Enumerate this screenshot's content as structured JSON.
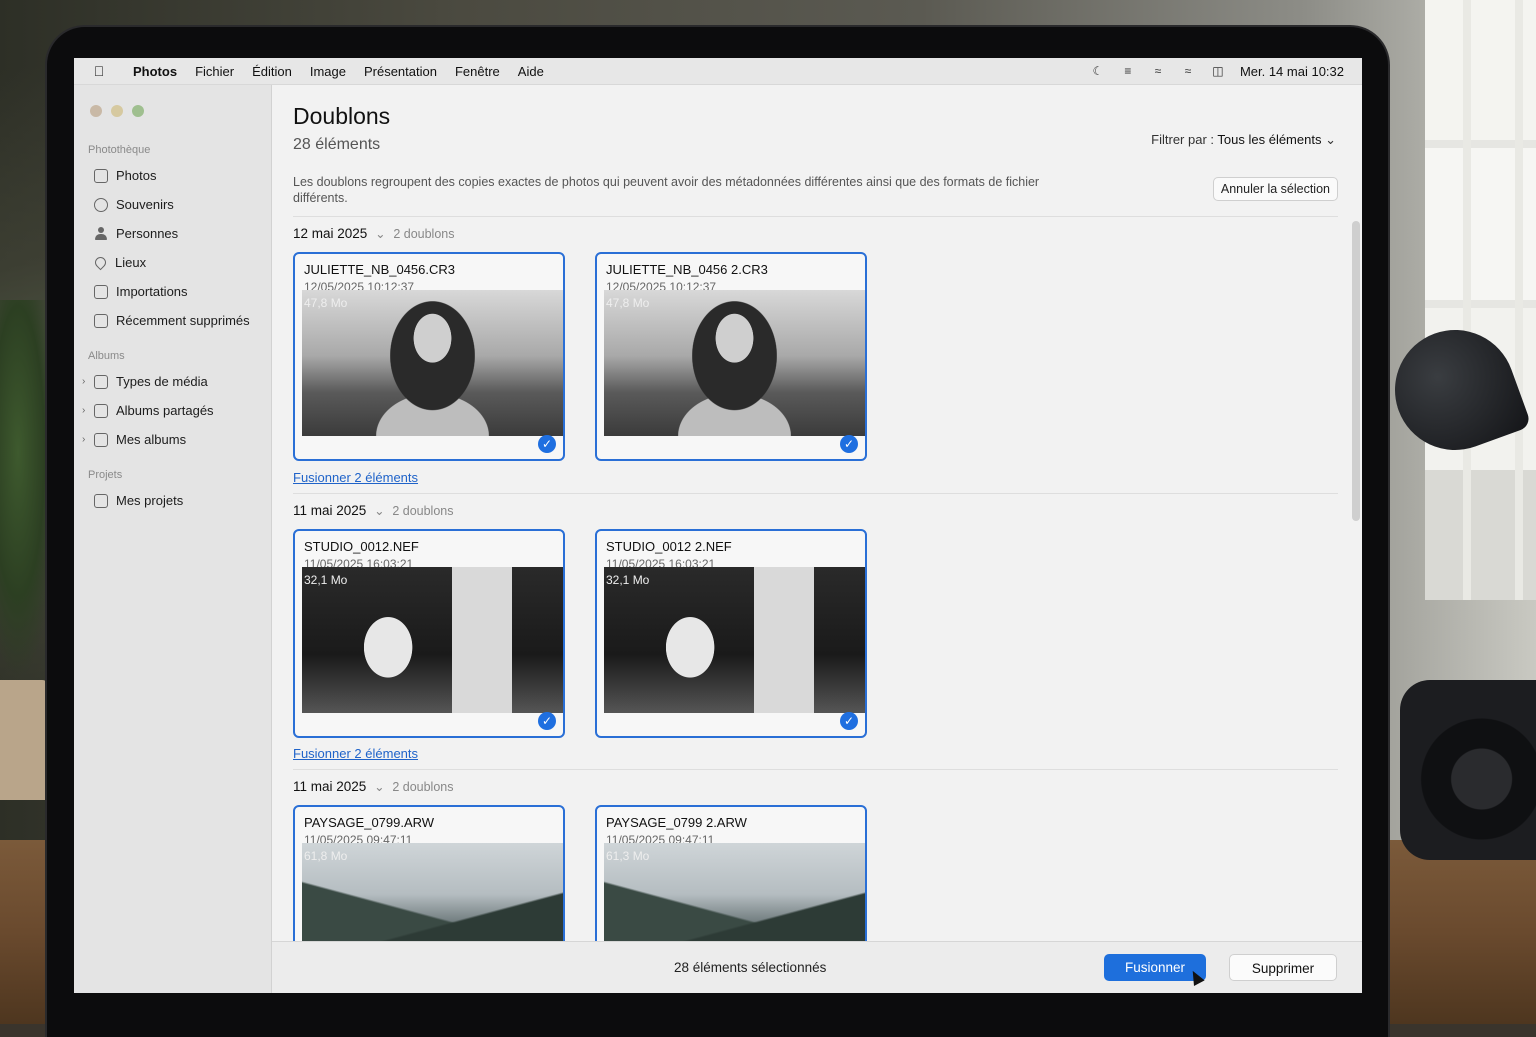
{
  "menubar": {
    "app": "Photos",
    "items": [
      "Fichier",
      "Édition",
      "Image",
      "Présentation",
      "Fenêtre",
      "Aide"
    ],
    "datetime": "Mer. 14 mai  10:32",
    "status_icons": [
      "focus-icon",
      "control-center-icon",
      "wifi-icon",
      "wifi-icon",
      "reader-icon"
    ]
  },
  "sidebar": {
    "sections": [
      {
        "label": "Photothèque",
        "items": [
          {
            "label": "Photos",
            "icon": "photos-icon"
          },
          {
            "label": "Souvenirs",
            "icon": "memories-icon"
          },
          {
            "label": "Personnes",
            "icon": "person-icon"
          },
          {
            "label": "Lieux",
            "icon": "pin-icon"
          },
          {
            "label": "Importations",
            "icon": "import-icon"
          },
          {
            "label": "Récemment supprimés",
            "icon": "trash-icon"
          }
        ]
      },
      {
        "label": "Albums",
        "items": [
          {
            "label": "Types de média",
            "icon": "folder-icon"
          },
          {
            "label": "Albums partagés",
            "icon": "shared-album-icon"
          },
          {
            "label": "Mes albums",
            "icon": "folder-icon"
          }
        ]
      },
      {
        "label": "Projets",
        "items": [
          {
            "label": "Mes projets",
            "icon": "folder-icon"
          }
        ]
      }
    ]
  },
  "main": {
    "title": "Doublons",
    "subtitle": "28 éléments",
    "filter_label": "Filtrer par :",
    "filter_value": "Tous les éléments",
    "description": "Les doublons regroupent des copies exactes de photos qui peuvent avoir des métadonnées différentes ainsi que des formats de fichier différents.",
    "cancel_selection": "Annuler la sélection",
    "groups": [
      {
        "date": "12 mai 2025",
        "count": "2 doublons",
        "merge": "Fusionner 2 éléments",
        "cards": [
          {
            "name": "JULIETTE_NB_0456.CR3",
            "meta": "12/05/2025   10:12:37",
            "size": "47,8 Mo"
          },
          {
            "name": "JULIETTE_NB_0456 2.CR3",
            "meta": "12/05/2025   10:12:37",
            "size": "47,8 Mo"
          }
        ]
      },
      {
        "date": "11 mai 2025",
        "count": "2 doublons",
        "merge": "Fusionner 2 éléments",
        "cards": [
          {
            "name": "STUDIO_0012.NEF",
            "meta": "11/05/2025   16:03:21",
            "size": "32,1 Mo"
          },
          {
            "name": "STUDIO_0012 2.NEF",
            "meta": "11/05/2025   16:03:21",
            "size": "32,1 Mo"
          }
        ]
      },
      {
        "date": "11 mai 2025",
        "count": "2 doublons",
        "cards": [
          {
            "name": "PAYSAGE_0799.ARW",
            "meta": "11/05/2025   09:47:11",
            "size": "61,8 Mo"
          },
          {
            "name": "PAYSAGE_0799 2.ARW",
            "meta": "11/05/2025   09:47:11",
            "size": "61,3 Mo"
          }
        ]
      }
    ]
  },
  "bottombar": {
    "selected": "28 éléments sélectionnés",
    "merge_button": "Fusionner",
    "delete_button": "Supprimer"
  },
  "colors": {
    "accent": "#1e6fdc",
    "card_border": "#2a6fd6",
    "link": "#1f63c9"
  }
}
